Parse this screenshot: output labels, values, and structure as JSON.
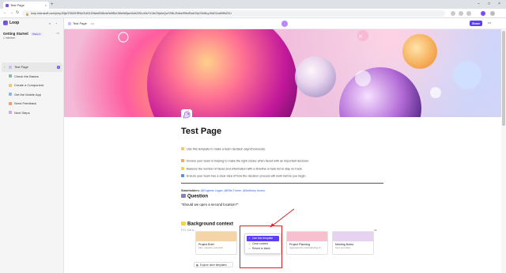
{
  "browser": {
    "tab_title": "Test Page",
    "tab_close": "×",
    "new_tab": "+",
    "window_controls": [
      "–",
      "□",
      "×"
    ],
    "nav": [
      "←",
      "→",
      "↻"
    ],
    "url": "loop.microsoft.com/p/eyJ0IjoiTGl5ZHR5cGUiOiJ2IiwidSI6Imh0dHBzOi8vbWljcm9zb2Z0LnNoYXJlcG9pbnQuY29tL2NvbnRlbnRzdG9yYWdlLyJ9dGVzdHBhZ2U",
    "lock_icon": "lock-icon"
  },
  "sidebar": {
    "brand": "Loop",
    "workspace": {
      "name": "Getting Started",
      "badge": "Shared",
      "members": "1 member",
      "more": "•••"
    },
    "items": [
      {
        "label": "Test Page",
        "color": "#c9c0f5",
        "active": true,
        "plus": "+"
      },
      {
        "label": "Check the Basics",
        "color": "#7cc1a3",
        "active": false
      },
      {
        "label": "Create a Component",
        "color": "#f0c96a",
        "active": false
      },
      {
        "label": "Get the Mobile App",
        "color": "#8fb2e8",
        "active": false
      },
      {
        "label": "Send Feedback",
        "color": "#f29b6b",
        "active": false
      },
      {
        "label": "Next Steps",
        "color": "#d8a4e6",
        "active": false
      }
    ]
  },
  "header": {
    "crumb": "Test Page",
    "crumb_more": "•••",
    "share": "Share",
    "more": "•••"
  },
  "document": {
    "title": "Test Page",
    "intro": "Use this template to make a team decision asynchronously.",
    "bullets": [
      "Involve your team in helping to make the right choice when faced with an important decision.",
      "Balance the number of ideas and information with a timeline or task list to stay on track.",
      "Ensure your team has a clear idea of how the decision process will work before you begin."
    ],
    "stakeholders_label": "Stakeholders:",
    "stakeholders": "@Eugenie Logan, @Ellis Turner, @Anthony Inomo",
    "question_heading": "Question",
    "question": "\"Should we open a second location?\"",
    "background_heading": "Background context",
    "faint_text": "FYI: I've h...",
    "faint_right": "ite"
  },
  "templates": {
    "cards": [
      {
        "title": "Project Brief",
        "subtitle": "Plan, organize, and track",
        "color": "#f5d4a8"
      },
      {
        "title": "Project Planning",
        "subtitle": "Aggregate the understanding ch...",
        "color": "#f8c0cf"
      },
      {
        "title": "Meeting Notes",
        "subtitle": "Sync and share",
        "color": "#e7d2f2"
      }
    ],
    "explore": "Explore other templates"
  },
  "context_menu": {
    "items": [
      {
        "label": "Use this template",
        "icon": "✓",
        "primary": true
      },
      {
        "label": "Clear content",
        "icon": "○",
        "primary": false
      },
      {
        "label": "Revert to blank",
        "icon": "○",
        "primary": false
      }
    ]
  },
  "colors": {
    "accent": "#5b3ef5",
    "highlight": "#e02020"
  }
}
